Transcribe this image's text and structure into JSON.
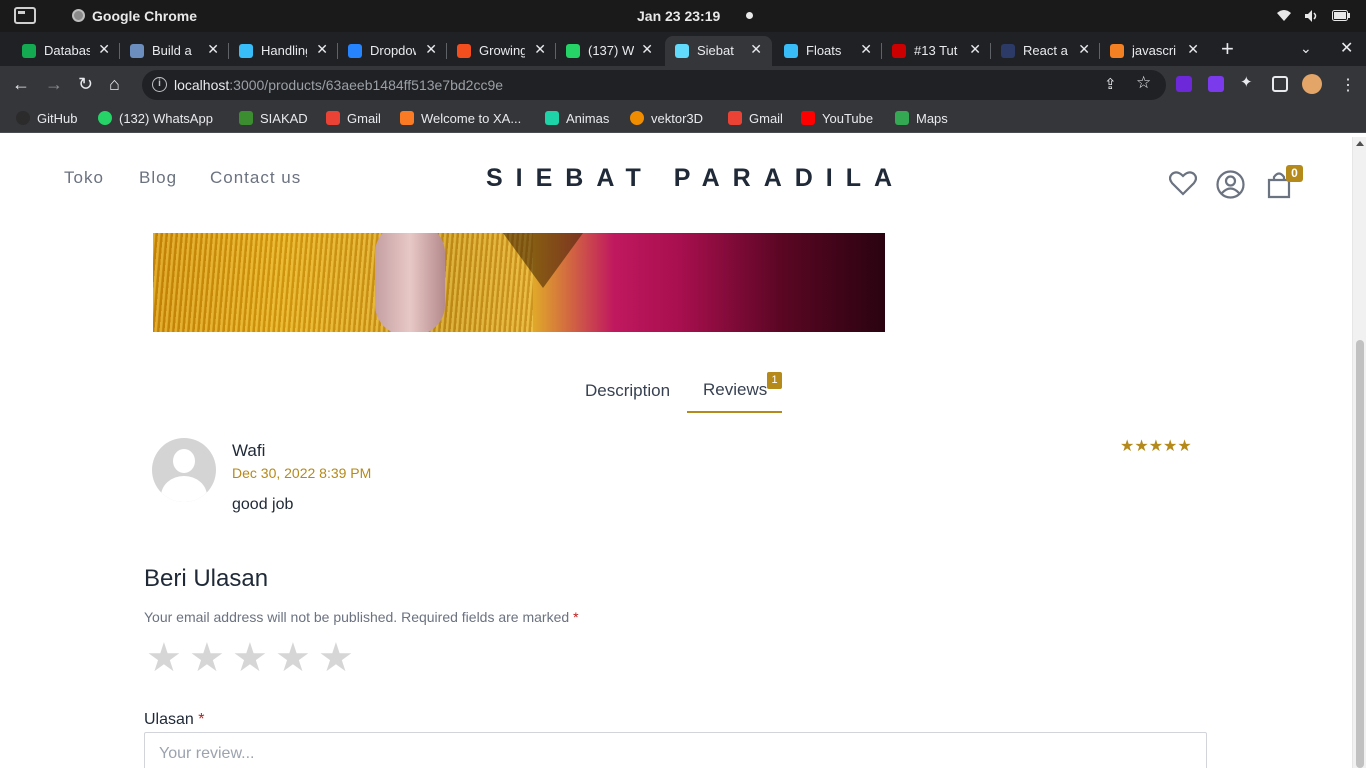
{
  "os": {
    "app_name": "Google Chrome",
    "clock": "Jan 23  23:19",
    "icons": [
      "wifi-icon",
      "volume-icon",
      "battery-icon"
    ]
  },
  "tabs": [
    {
      "label": "Database",
      "favicon": "mongodb-favicon",
      "color": "#13aa52"
    },
    {
      "label": "Build a",
      "favicon": "laptop-favicon",
      "color": "#6c8ebf"
    },
    {
      "label": "Handling",
      "favicon": "tailwind-favicon",
      "color": "#38bdf8"
    },
    {
      "label": "Dropdown",
      "favicon": "diamond-favicon",
      "color": "#2684ff"
    },
    {
      "label": "Growing",
      "favicon": "figma-favicon",
      "color": "#f24e1e"
    },
    {
      "label": "(137) W",
      "favicon": "whatsapp-favicon",
      "color": "#25d366"
    },
    {
      "label": "Siebat",
      "favicon": "react-favicon",
      "color": "#61dafb",
      "active": true
    },
    {
      "label": "Floats",
      "favicon": "tailwind-favicon",
      "color": "#38bdf8"
    },
    {
      "label": "#13 Tut",
      "favicon": "video-favicon",
      "color": "#cc0000"
    },
    {
      "label": "React a",
      "favicon": "dev-favicon",
      "color": "#2b3a67"
    },
    {
      "label": "javascri",
      "favicon": "stackoverflow-favicon",
      "color": "#f48024"
    }
  ],
  "toolbar": {
    "url_host": "localhost",
    "url_path": ":3000/products/63aeeb1484ff513e7bd2cc9e"
  },
  "bookmarks": [
    {
      "label": "GitHub",
      "color": "#2b2b2b"
    },
    {
      "label": "(132) WhatsApp",
      "color": "#25d366"
    },
    {
      "label": "SIAKAD",
      "color": "#3c8d2f"
    },
    {
      "label": "Gmail",
      "color": "#ea4335"
    },
    {
      "label": "Welcome to XA...",
      "color": "#fb7a24"
    },
    {
      "label": "Animas",
      "color": "#1dd3a7"
    },
    {
      "label": "vektor3D",
      "color": "#f08c00"
    },
    {
      "label": "Gmail",
      "color": "#ea4335"
    },
    {
      "label": "YouTube",
      "color": "#ff0000"
    },
    {
      "label": "Maps",
      "color": "#34a853"
    }
  ],
  "site": {
    "nav": [
      "Toko",
      "Blog",
      "Contact us"
    ],
    "brand": "SIEBAT PARADILA",
    "cart_count": "0",
    "accent": "#b58a1b"
  },
  "product_tabs": {
    "description": "Description",
    "reviews": "Reviews",
    "reviews_count": "1"
  },
  "review": {
    "author": "Wafi",
    "date": "Dec 30, 2022 8:39 PM",
    "text": "good job",
    "rating": 5,
    "stars": "★★★★★"
  },
  "review_form": {
    "title": "Beri Ulasan",
    "note": "Your email address will not be published. Required fields are marked ",
    "required_mark": "*",
    "rating_stars": [
      "★",
      "★",
      "★",
      "★",
      "★"
    ],
    "field_label": "Ulasan ",
    "placeholder": "Your review..."
  }
}
